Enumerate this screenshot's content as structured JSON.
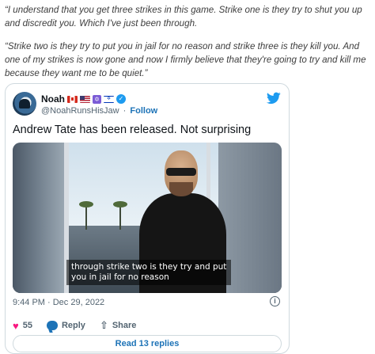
{
  "article": {
    "quote_1": "“I understand that you get three strikes in this game. Strike one is they try to shut you up and discredit you. Which I've just been through.",
    "quote_2": "“Strike two is they try to put you in jail for no reason and strike three is they kill you. And one of my strikes is now gone and now I firmly believe that they're going to try and kill me because they want me to be quiet.”"
  },
  "tweet": {
    "author_name": "Noah",
    "handle": "@NoahRunsHisJaw",
    "separator": "·",
    "follow_label": "Follow",
    "text": "Andrew Tate has been released. Not surprising",
    "video_caption_line1": "through strike two is they try and put",
    "video_caption_line2": "you in jail for no reason",
    "timestamp": "9:44 PM · Dec 29, 2022",
    "like_count": "55",
    "reply_label": "Reply",
    "share_label": "Share",
    "read_replies_label": "Read 13 replies",
    "icons": [
      "avatar",
      "canada-flag-icon",
      "us-flag-icon",
      "star-of-david-icon",
      "israel-flag-icon",
      "verified-badge-icon",
      "twitter-logo-icon",
      "info-icon",
      "heart-icon",
      "reply-icon",
      "share-icon"
    ],
    "colors": {
      "link": "#1d73b7",
      "like": "#f91880",
      "verified": "#1d9bf0"
    }
  }
}
